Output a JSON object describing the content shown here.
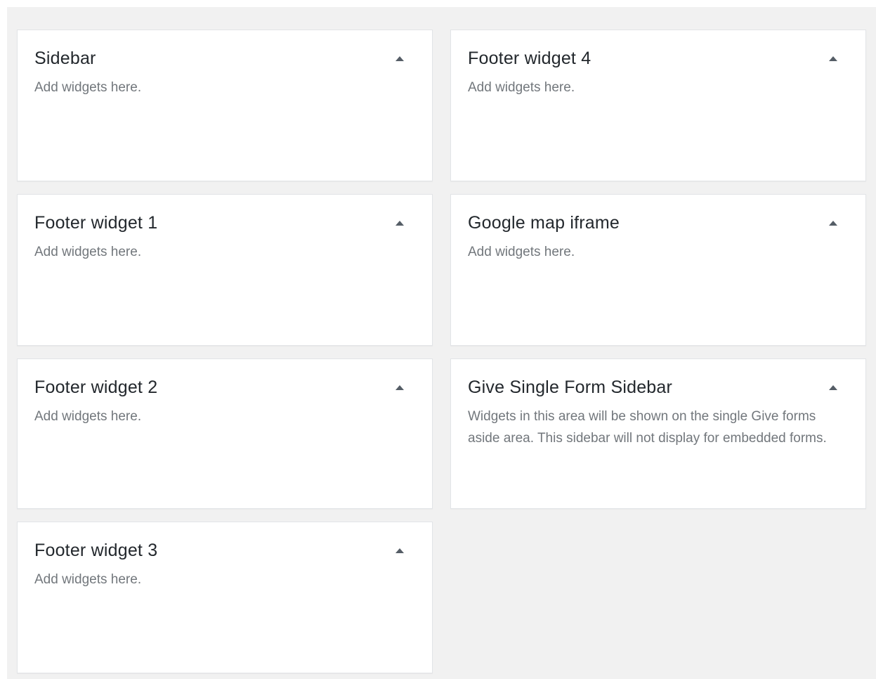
{
  "widget_areas_left": [
    {
      "title": "Sidebar",
      "description": "Add widgets here."
    },
    {
      "title": "Footer widget 1",
      "description": "Add widgets here."
    },
    {
      "title": "Footer widget 2",
      "description": "Add widgets here."
    },
    {
      "title": "Footer widget 3",
      "description": "Add widgets here."
    }
  ],
  "widget_areas_right": [
    {
      "title": "Footer widget 4",
      "description": "Add widgets here."
    },
    {
      "title": "Google map iframe",
      "description": "Add widgets here."
    },
    {
      "title": "Give Single Form Sidebar",
      "description": "Widgets in this area will be shown on the single Give forms aside area. This sidebar will not display for embedded forms."
    }
  ],
  "toggle_icon": "arrow-up-icon",
  "colors": {
    "page_background": "#f1f1f1",
    "card_background": "#ffffff",
    "title_text": "#23282d",
    "description_text": "#72777c"
  }
}
